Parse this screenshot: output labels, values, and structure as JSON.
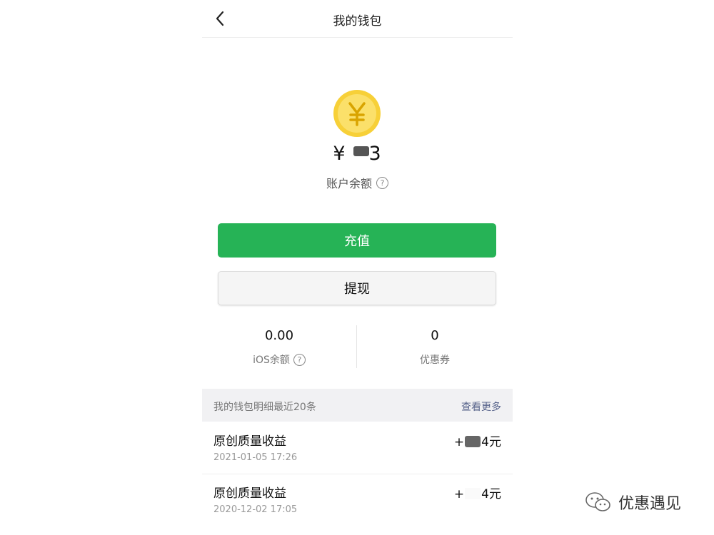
{
  "header": {
    "title": "我的钱包"
  },
  "balance": {
    "currency": "¥",
    "amount_tail": "3",
    "label": "账户余额"
  },
  "actions": {
    "recharge_label": "充值",
    "withdraw_label": "提现"
  },
  "stats": {
    "ios_value": "0.00",
    "ios_label": "iOS余额",
    "coupon_value": "0",
    "coupon_label": "优惠券"
  },
  "details": {
    "title": "我的钱包明细最近20条",
    "more_label": "查看更多",
    "items": [
      {
        "title": "原创质量收益",
        "date": "2021-01-05 17:26",
        "amount_prefix": "+",
        "amount_suffix": "4元"
      },
      {
        "title": "原创质量收益",
        "date": "2020-12-02 17:05",
        "amount_prefix": "+",
        "amount_suffix": "4元"
      }
    ]
  },
  "watermark": {
    "text": "优惠遇见"
  },
  "colors": {
    "primary_green": "#26b356",
    "coin_yellow": "#f7d038",
    "link_blue": "#56628a"
  },
  "icons": {
    "back": "chevron-left-icon",
    "coin": "yuan-coin-icon",
    "help": "question-circle-icon",
    "wechat": "wechat-icon"
  }
}
